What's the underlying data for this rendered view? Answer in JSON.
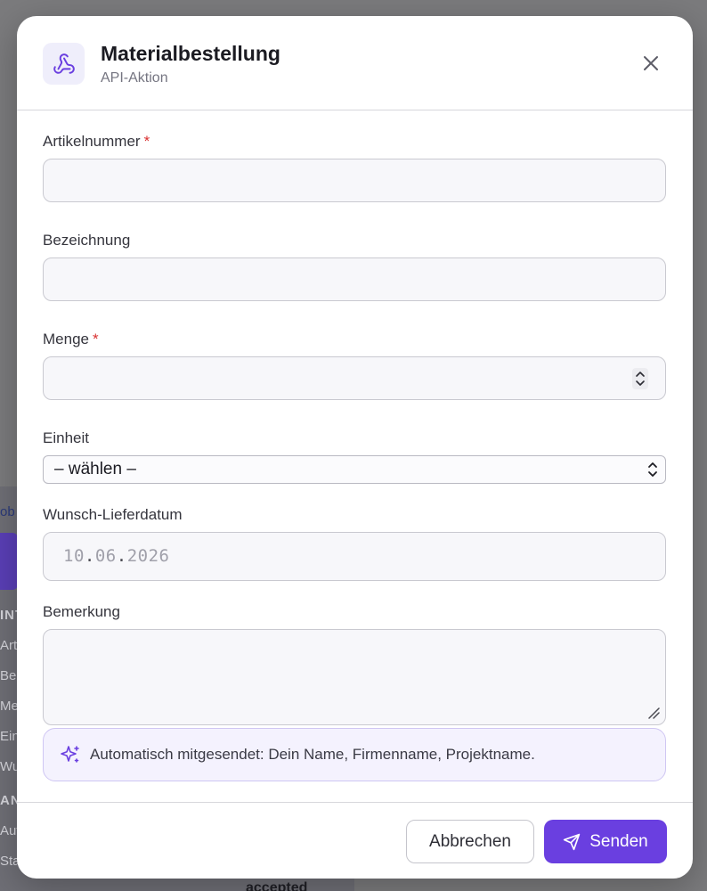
{
  "background": {
    "link_fragment": "ob",
    "rows": [
      "INT",
      "Arti",
      "Bez",
      "Mer",
      "Einh",
      "Wu",
      "ANT",
      "Auf",
      "Sta"
    ],
    "accepted": "accepted"
  },
  "modal": {
    "title": "Materialbestellung",
    "subtitle": "API-Aktion",
    "icon": "webhook-icon",
    "close_icon": "close-icon"
  },
  "form": {
    "artikelnummer": {
      "label": "Artikelnummer",
      "required": "*",
      "value": ""
    },
    "bezeichnung": {
      "label": "Bezeichnung",
      "value": ""
    },
    "menge": {
      "label": "Menge",
      "required": "*",
      "value": ""
    },
    "einheit": {
      "label": "Einheit",
      "selected": "– wählen –"
    },
    "wunsch_lieferdatum": {
      "label": "Wunsch-Lieferdatum",
      "day": "10",
      "sep1": ".",
      "month": "06",
      "sep2": ".",
      "year": "2026"
    },
    "bemerkung": {
      "label": "Bemerkung",
      "value": ""
    }
  },
  "info": {
    "icon": "sparkles-icon",
    "text": "Automatisch mitgesendet: Dein Name, Firmenname, Projektname."
  },
  "footer": {
    "cancel_label": "Abbrechen",
    "send_label": "Senden",
    "send_icon": "send-icon"
  },
  "colors": {
    "accent": "#6a3fe0",
    "required": "#d93030",
    "info_bg": "#f4f2fe"
  }
}
